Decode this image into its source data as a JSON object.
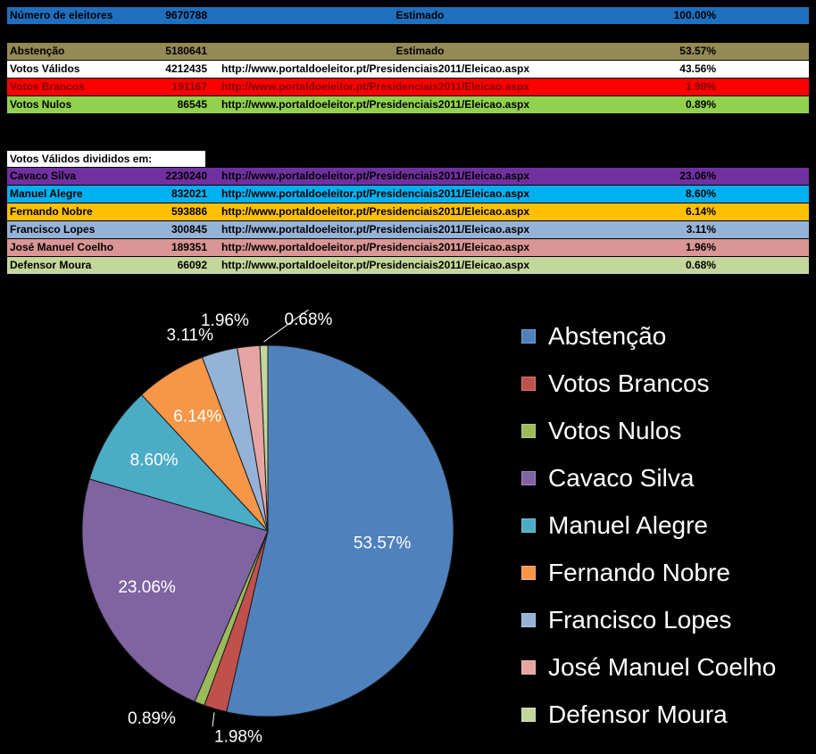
{
  "table": {
    "total": {
      "name": "Número de eleitores",
      "count": "9670788",
      "source": "Estimado",
      "pct": "100.00%",
      "bg": "#1f6fbf",
      "fg": "#000000"
    },
    "breakdown": [
      {
        "name": "Abstenção",
        "count": "5180641",
        "source": "Estimado",
        "pct": "53.57%",
        "bg": "#948a54",
        "fg": "#000000"
      },
      {
        "name": "Votos Válidos",
        "count": "4212435",
        "source": "http://www.portaldoeleitor.pt/Presidenciais2011/Eleicao.aspx",
        "pct": "43.56%",
        "bg": "#ffffff",
        "fg": "#000000"
      },
      {
        "name": "Votos Brancos",
        "count": "191167",
        "source": "http://www.portaldoeleitor.pt/Presidenciais2011/Eleicao.aspx",
        "pct": "1.98%",
        "bg": "#ff0000",
        "fg": "#7f0000"
      },
      {
        "name": "Votos Nulos",
        "count": "86545",
        "source": "http://www.portaldoeleitor.pt/Presidenciais2011/Eleicao.aspx",
        "pct": "0.89%",
        "bg": "#92d050",
        "fg": "#000000"
      }
    ],
    "valid_heading": "Votos Válidos divididos em:",
    "candidates": [
      {
        "name": "Cavaco Silva",
        "count": "2230240",
        "source": "http://www.portaldoeleitor.pt/Presidenciais2011/Eleicao.aspx",
        "pct": "23.06%",
        "bg": "#7030a0",
        "fg": "#000000"
      },
      {
        "name": "Manuel Alegre",
        "count": "832021",
        "source": "http://www.portaldoeleitor.pt/Presidenciais2011/Eleicao.aspx",
        "pct": "8.60%",
        "bg": "#00b0f0",
        "fg": "#000000"
      },
      {
        "name": "Fernando Nobre",
        "count": "593886",
        "source": "http://www.portaldoeleitor.pt/Presidenciais2011/Eleicao.aspx",
        "pct": "6.14%",
        "bg": "#ffc000",
        "fg": "#000000"
      },
      {
        "name": "Francisco Lopes",
        "count": "300845",
        "source": "http://www.portaldoeleitor.pt/Presidenciais2011/Eleicao.aspx",
        "pct": "3.11%",
        "bg": "#95b3d7",
        "fg": "#000000"
      },
      {
        "name": "José Manuel Coelho",
        "count": "189351",
        "source": "http://www.portaldoeleitor.pt/Presidenciais2011/Eleicao.aspx",
        "pct": "1.96%",
        "bg": "#da9694",
        "fg": "#000000"
      },
      {
        "name": "Defensor Moura",
        "count": "66092",
        "source": "http://www.portaldoeleitor.pt/Presidenciais2011/Eleicao.aspx",
        "pct": "0.68%",
        "bg": "#c4d79b",
        "fg": "#000000"
      }
    ]
  },
  "chart_data": {
    "type": "pie",
    "legend_position": "right",
    "slices": [
      {
        "name": "Abstenção",
        "value": 53.57,
        "label": "53.57%",
        "color": "#4f81bd"
      },
      {
        "name": "Votos Brancos",
        "value": 1.98,
        "label": "1.98%",
        "color": "#c0504d"
      },
      {
        "name": "Votos Nulos",
        "value": 0.89,
        "label": "0.89%",
        "color": "#9bbb59"
      },
      {
        "name": "Cavaco Silva",
        "value": 23.06,
        "label": "23.06%",
        "color": "#8064a2"
      },
      {
        "name": "Manuel Alegre",
        "value": 8.6,
        "label": "8.60%",
        "color": "#4bacc6"
      },
      {
        "name": "Fernando Nobre",
        "value": 6.14,
        "label": "6.14%",
        "color": "#f79646"
      },
      {
        "name": "Francisco Lopes",
        "value": 3.11,
        "label": "3.11%",
        "color": "#95b3d7"
      },
      {
        "name": "José Manuel Coelho",
        "value": 1.96,
        "label": "1.96%",
        "color": "#e6a5a3"
      },
      {
        "name": "Defensor Moura",
        "value": 0.68,
        "label": "0.68%",
        "color": "#c3d69b"
      }
    ]
  }
}
